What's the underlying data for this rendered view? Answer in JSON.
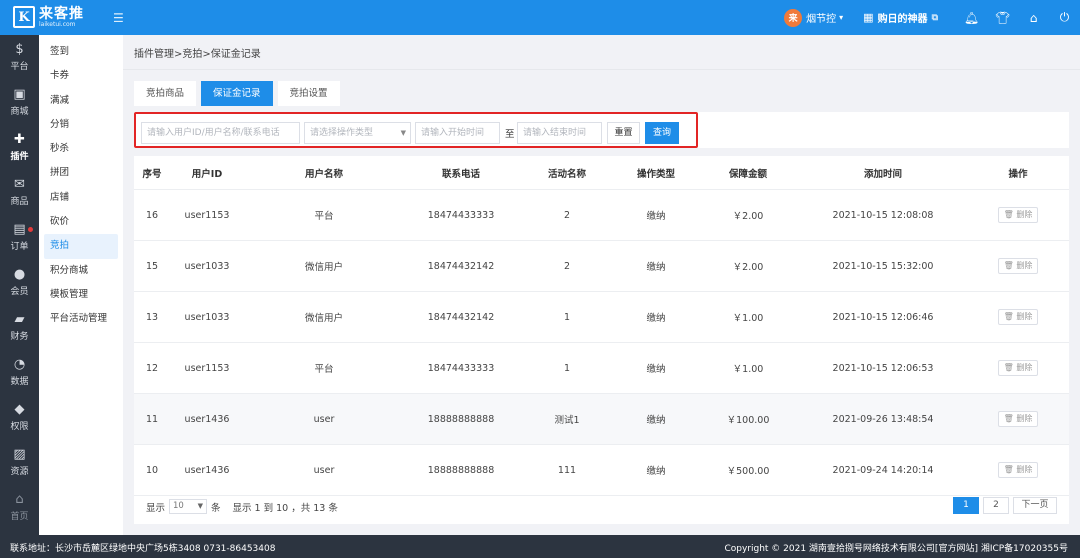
{
  "header": {
    "logo_char": "K",
    "logo_name": "来客推",
    "logo_domain": "laiketui.com",
    "menu_toggle_icon": "hamburger-icon",
    "user_avatar_char": "来",
    "user_name": "烟节控",
    "shop_name": "购日的神器",
    "top_icons": [
      "bell-icon",
      "shirt-icon",
      "home-icon",
      "power-icon"
    ]
  },
  "nav_main": [
    {
      "label": "平台",
      "icon": "$"
    },
    {
      "label": "商城",
      "icon": "▣"
    },
    {
      "label": "插件",
      "icon": "✚",
      "active": true
    },
    {
      "label": "商品",
      "icon": "✉"
    },
    {
      "label": "订单",
      "icon": "▤",
      "badge": true
    },
    {
      "label": "会员",
      "icon": "●"
    },
    {
      "label": "财务",
      "icon": "▰"
    },
    {
      "label": "数据",
      "icon": "◔"
    },
    {
      "label": "权限",
      "icon": "◆"
    },
    {
      "label": "资源",
      "icon": "▨"
    },
    {
      "label": "首页",
      "icon": "⌂",
      "dim": true
    }
  ],
  "nav_sub": [
    {
      "label": "签到"
    },
    {
      "label": "卡券"
    },
    {
      "label": "满减"
    },
    {
      "label": "分销"
    },
    {
      "label": "秒杀"
    },
    {
      "label": "拼团"
    },
    {
      "label": "店铺"
    },
    {
      "label": "砍价"
    },
    {
      "label": "竞拍",
      "active": true
    },
    {
      "label": "积分商城"
    },
    {
      "label": "模板管理"
    },
    {
      "label": "平台活动管理"
    }
  ],
  "breadcrumb": "插件管理>竞拍>保证金记录",
  "tabs": [
    {
      "label": "竞拍商品"
    },
    {
      "label": "保证金记录",
      "active": true
    },
    {
      "label": "竞拍设置"
    }
  ],
  "filters": {
    "user_placeholder": "请输入用户ID/用户名称/联系电话",
    "type_placeholder": "请选择操作类型",
    "start_placeholder": "请输入开始时间",
    "to_label": "至",
    "end_placeholder": "请输入结束时间",
    "reset_label": "重置",
    "query_label": "查询"
  },
  "table": {
    "headers": [
      "序号",
      "用户ID",
      "用户名称",
      "联系电话",
      "活动名称",
      "操作类型",
      "保障金额",
      "添加时间",
      "操作"
    ],
    "rows": [
      {
        "no": "16",
        "uid": "user1153",
        "name": "平台",
        "phone": "18474433333",
        "activity": "2",
        "type": "缴纳",
        "amount": "￥2.00",
        "time": "2021-10-15 12:08:08",
        "action": "删除"
      },
      {
        "no": "15",
        "uid": "user1033",
        "name": "微信用户",
        "phone": "18474432142",
        "activity": "2",
        "type": "缴纳",
        "amount": "￥2.00",
        "time": "2021-10-15 15:32:00",
        "action": "删除"
      },
      {
        "no": "13",
        "uid": "user1033",
        "name": "微信用户",
        "phone": "18474432142",
        "activity": "1",
        "type": "缴纳",
        "amount": "￥1.00",
        "time": "2021-10-15 12:06:46",
        "action": "删除"
      },
      {
        "no": "12",
        "uid": "user1153",
        "name": "平台",
        "phone": "18474433333",
        "activity": "1",
        "type": "缴纳",
        "amount": "￥1.00",
        "time": "2021-10-15 12:06:53",
        "action": "删除"
      },
      {
        "no": "11",
        "uid": "user1436",
        "name": "user",
        "phone": "18888888888",
        "activity": "测试1",
        "type": "缴纳",
        "amount": "￥100.00",
        "time": "2021-09-26 13:48:54",
        "action": "删除"
      },
      {
        "no": "10",
        "uid": "user1436",
        "name": "user",
        "phone": "18888888888",
        "activity": "111",
        "type": "缴纳",
        "amount": "￥500.00",
        "time": "2021-09-24 14:20:14",
        "action": "删除"
      }
    ]
  },
  "pagination": {
    "show_label": "显示",
    "page_size": "10",
    "unit_label": "条",
    "summary": "显示 1 到 10 ，共 13 条",
    "pages": [
      "1",
      "2"
    ],
    "current": "1",
    "next_label": "下一页"
  },
  "footer": {
    "address": "联系地址：长沙市岳麓区绿地中央广场5栋3408 0731-86453408",
    "copyright": "Copyright © 2021 湖南壹拾捌号网络技术有限公司[官方网站]  湘ICP备17020355号"
  }
}
